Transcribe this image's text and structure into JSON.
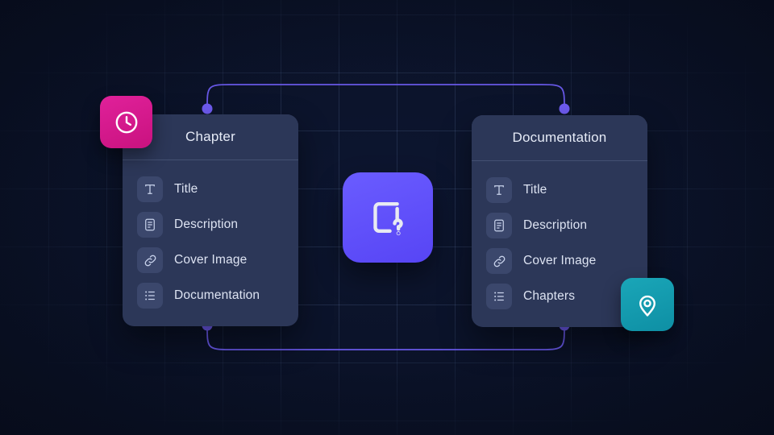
{
  "canvas": {
    "background_color": "#0a1126",
    "grid_color": "#84a4dc",
    "connector_color": "#6d5cf0",
    "node_dot_color": "#6f5cf2"
  },
  "cards": [
    {
      "id": "chapter",
      "title": "Chapter",
      "fields": [
        {
          "label": "Title",
          "icon": "text-icon"
        },
        {
          "label": "Description",
          "icon": "document-text-icon"
        },
        {
          "label": "Cover Image",
          "icon": "link-icon"
        },
        {
          "label": "Documentation",
          "icon": "list-icon"
        }
      ]
    },
    {
      "id": "documentation",
      "title": "Documentation",
      "fields": [
        {
          "label": "Title",
          "icon": "text-icon"
        },
        {
          "label": "Description",
          "icon": "document-text-icon"
        },
        {
          "label": "Cover Image",
          "icon": "link-icon"
        },
        {
          "label": "Chapters",
          "icon": "list-icon"
        }
      ]
    }
  ],
  "badges": {
    "clock": {
      "icon": "clock-icon",
      "color": "#d81b8c"
    },
    "pin": {
      "icon": "map-pin-icon",
      "color": "#0e96ab"
    },
    "center": {
      "icon": "document-question-icon",
      "color": "#5f4ef8"
    }
  },
  "connectors": [
    {
      "id": "top-connector",
      "from": "chapter-top-port",
      "to": "documentation-top-port"
    },
    {
      "id": "bottom-connector",
      "from": "chapter-bottom-port",
      "to": "documentation-bottom-port"
    }
  ]
}
